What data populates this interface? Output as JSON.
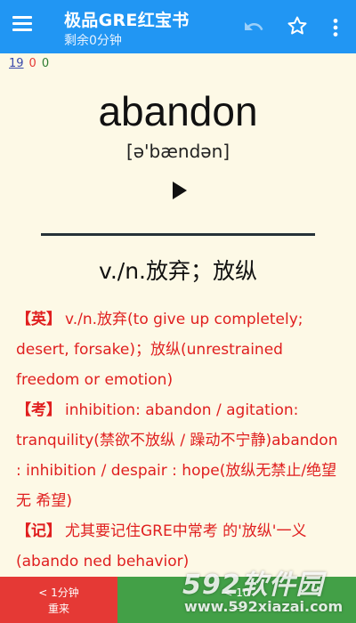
{
  "appbar": {
    "title": "极品GRE红宝书",
    "subtitle": "剩余0分钟",
    "icons": [
      "menu-icon",
      "undo-icon",
      "star-outline-icon",
      "more-vert-icon"
    ]
  },
  "stats": {
    "blue": "19",
    "red": "0",
    "green": "0"
  },
  "word": {
    "headword": "abandon",
    "phonetic": "[ə'bændən]",
    "meaning": "v./n.放弃；放纵"
  },
  "details": [
    {
      "tag": "【英】",
      "text": "v./n.放弃(to give up completely; desert, forsake)；放纵(unrestrained freedom or emotion)"
    },
    {
      "tag": "【考】",
      "text": "inhibition: abandon / agitation: tranquility(禁欲不放纵 / 躁动不宁静)abandon : inhibition / despair : hope(放纵无禁止/绝望无 希望)"
    },
    {
      "tag": "【记】",
      "text": "尤其要记住GRE中常考 的'放纵'一义(abando ned behavior)"
    }
  ],
  "bottom": {
    "left": {
      "line1": "< 1分钟",
      "line2": "重来"
    },
    "right": {
      "line1": "< 10",
      "line2": "一"
    }
  },
  "watermark": {
    "main": "592软件园",
    "sub": "www.592xiazai.com"
  },
  "colors": {
    "appbar": "#2196f3",
    "details": "#e01f1f",
    "retry": "#e53935",
    "next": "#43a047",
    "background": "#fdf9e6"
  }
}
